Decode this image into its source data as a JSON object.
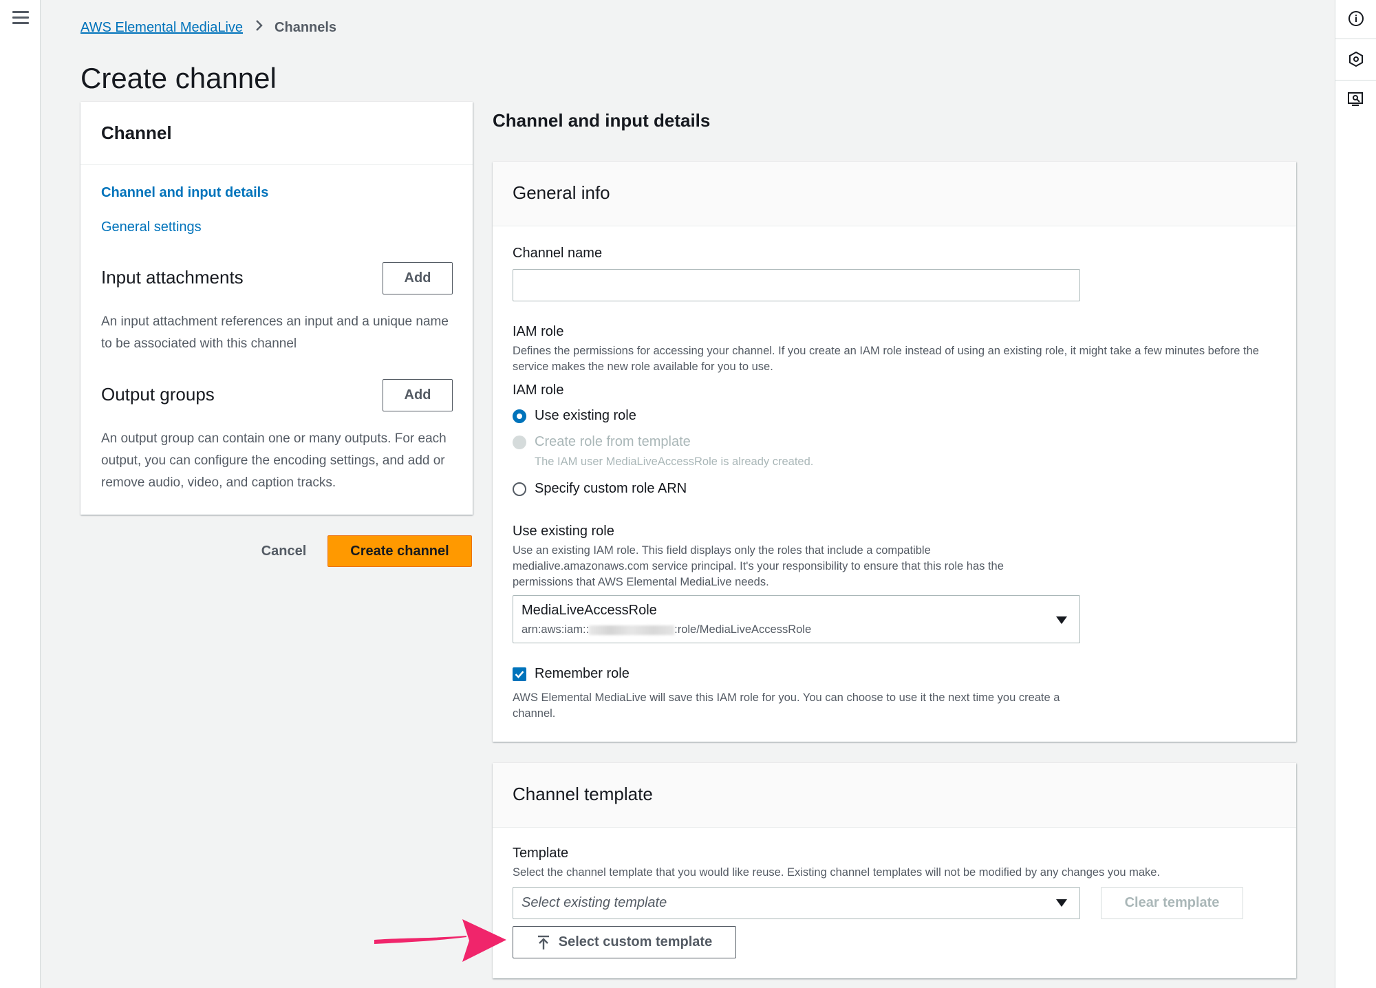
{
  "breadcrumb": {
    "parent": "AWS Elemental MediaLive",
    "current": "Channels"
  },
  "page_title": "Create channel",
  "nav": {
    "title": "Channel",
    "links": [
      "Channel and input details",
      "General settings"
    ],
    "input_attachments": {
      "title": "Input attachments",
      "add_label": "Add",
      "description": "An input attachment references an input and a unique name to be associated with this channel"
    },
    "output_groups": {
      "title": "Output groups",
      "add_label": "Add",
      "description": "An output group can contain one or many outputs. For each output, you can configure the encoding settings, and add or remove audio, video, and caption tracks."
    }
  },
  "actions": {
    "cancel_label": "Cancel",
    "create_label": "Create channel"
  },
  "main": {
    "section_heading": "Channel and input details",
    "general_info": {
      "title": "General info",
      "channel_name_label": "Channel name",
      "channel_name_value": "",
      "iam_role_label": "IAM role",
      "iam_role_description": "Defines the permissions for accessing your channel. If you create an IAM role instead of using an existing role, it might take a few minutes before the service makes the new role available for you to use.",
      "iam_role_group_label": "IAM role",
      "radio_options": [
        {
          "label": "Use existing role",
          "state": "checked"
        },
        {
          "label": "Create role from template",
          "state": "disabled",
          "sublabel": "The IAM user MediaLiveAccessRole is already created."
        },
        {
          "label": "Specify custom role ARN",
          "state": "unchecked"
        }
      ],
      "existing_role_label": "Use existing role",
      "existing_role_description": "Use an existing IAM role. This field displays only the roles that include a compatible medialive.amazonaws.com service principal. It's your responsibility to ensure that this role has the permissions that AWS Elemental MediaLive needs.",
      "role_select_value": "MediaLiveAccessRole",
      "role_arn_prefix": "arn:aws:iam::",
      "role_arn_suffix": ":role/MediaLiveAccessRole",
      "remember_label": "Remember role",
      "remember_checked": true,
      "remember_description": "AWS Elemental MediaLive will save this IAM role for you. You can choose to use it the next time you create a channel."
    },
    "channel_template": {
      "title": "Channel template",
      "template_label": "Template",
      "template_description": "Select the channel template that you would like reuse. Existing channel templates will not be modified by any changes you make.",
      "select_placeholder": "Select existing template",
      "clear_label": "Clear template",
      "custom_label": "Select custom template"
    }
  },
  "annotation": {
    "arrow_color": "#f0256b"
  },
  "colors": {
    "link": "#0073bb",
    "primary": "#ff9900",
    "background": "#f2f3f3"
  },
  "icons": [
    "menu-icon",
    "info-icon",
    "settings-hexagon-icon",
    "feedback-icon",
    "upload-icon",
    "chevron-right-icon",
    "caret-down-icon",
    "checkmark-icon"
  ]
}
